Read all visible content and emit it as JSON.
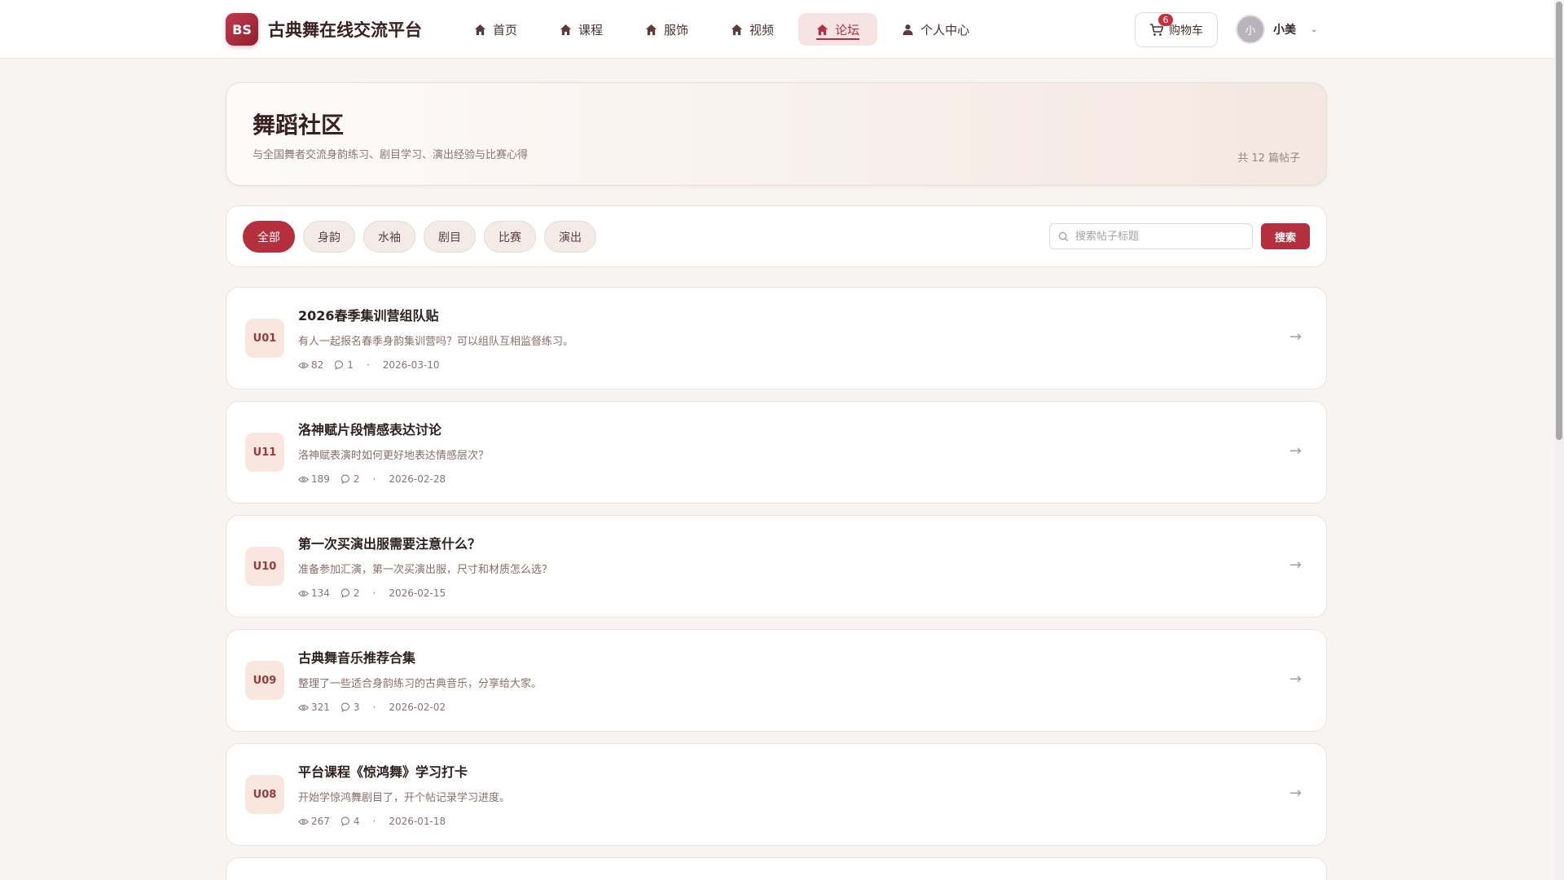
{
  "brand": {
    "logo": "BS",
    "name": "古典舞在线交流平台"
  },
  "nav": [
    {
      "label": "首页",
      "icon": "home-icon"
    },
    {
      "label": "课程",
      "icon": "home-icon"
    },
    {
      "label": "服饰",
      "icon": "home-icon"
    },
    {
      "label": "视频",
      "icon": "home-icon"
    },
    {
      "label": "论坛",
      "icon": "home-icon",
      "active": true
    },
    {
      "label": "个人中心",
      "icon": "user-icon"
    }
  ],
  "cart": {
    "label": "购物车",
    "badge": "6"
  },
  "user": {
    "avatar": "小",
    "name": "小美"
  },
  "hero": {
    "title": "舞蹈社区",
    "subtitle": "与全国舞者交流身韵练习、剧目学习、演出经验与比赛心得",
    "count": "共 12 篇帖子"
  },
  "filters": [
    "全部",
    "身韵",
    "水袖",
    "剧目",
    "比赛",
    "演出"
  ],
  "search": {
    "placeholder": "搜索帖子标题",
    "button": "搜索"
  },
  "posts": [
    {
      "tag": "U01",
      "title": "2026春季集训营组队贴",
      "desc": "有人一起报名春季身韵集训营吗？可以组队互相监督练习。",
      "views": "82",
      "comments": "1",
      "date": "2026-03-10"
    },
    {
      "tag": "U11",
      "title": "洛神赋片段情感表达讨论",
      "desc": "洛神赋表演时如何更好地表达情感层次？",
      "views": "189",
      "comments": "2",
      "date": "2026-02-28"
    },
    {
      "tag": "U10",
      "title": "第一次买演出服需要注意什么？",
      "desc": "准备参加汇演，第一次买演出服，尺寸和材质怎么选？",
      "views": "134",
      "comments": "2",
      "date": "2026-02-15"
    },
    {
      "tag": "U09",
      "title": "古典舞音乐推荐合集",
      "desc": "整理了一些适合身韵练习的古典音乐，分享给大家。",
      "views": "321",
      "comments": "3",
      "date": "2026-02-02"
    },
    {
      "tag": "U08",
      "title": "平台课程《惊鸿舞》学习打卡",
      "desc": "开始学惊鸿舞剧目了，开个帖记录学习进度。",
      "views": "267",
      "comments": "4",
      "date": "2026-01-18"
    }
  ],
  "colors": {
    "accent": "#b4303f",
    "background": "#f8f4f1"
  }
}
